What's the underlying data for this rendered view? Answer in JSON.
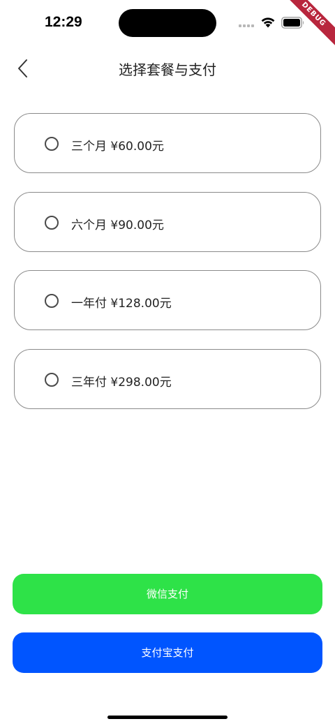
{
  "status_bar": {
    "time": "12:29",
    "debug_banner": "DEBUG"
  },
  "header": {
    "title": "选择套餐与支付"
  },
  "plans": [
    {
      "label": "三个月 ¥60.00元",
      "selected": false
    },
    {
      "label": "六个月 ¥90.00元",
      "selected": false
    },
    {
      "label": "一年付 ¥128.00元",
      "selected": false
    },
    {
      "label": "三年付 ¥298.00元",
      "selected": false
    }
  ],
  "payment": {
    "wechat_label": "微信支付",
    "alipay_label": "支付宝支付",
    "wechat_color": "#2EE248",
    "alipay_color": "#0055FF"
  },
  "icons": {
    "back": "chevron-left-icon",
    "radio": "radio-unchecked-icon",
    "wifi": "wifi-icon",
    "battery": "battery-icon",
    "signal": "cellular-signal-icon"
  }
}
